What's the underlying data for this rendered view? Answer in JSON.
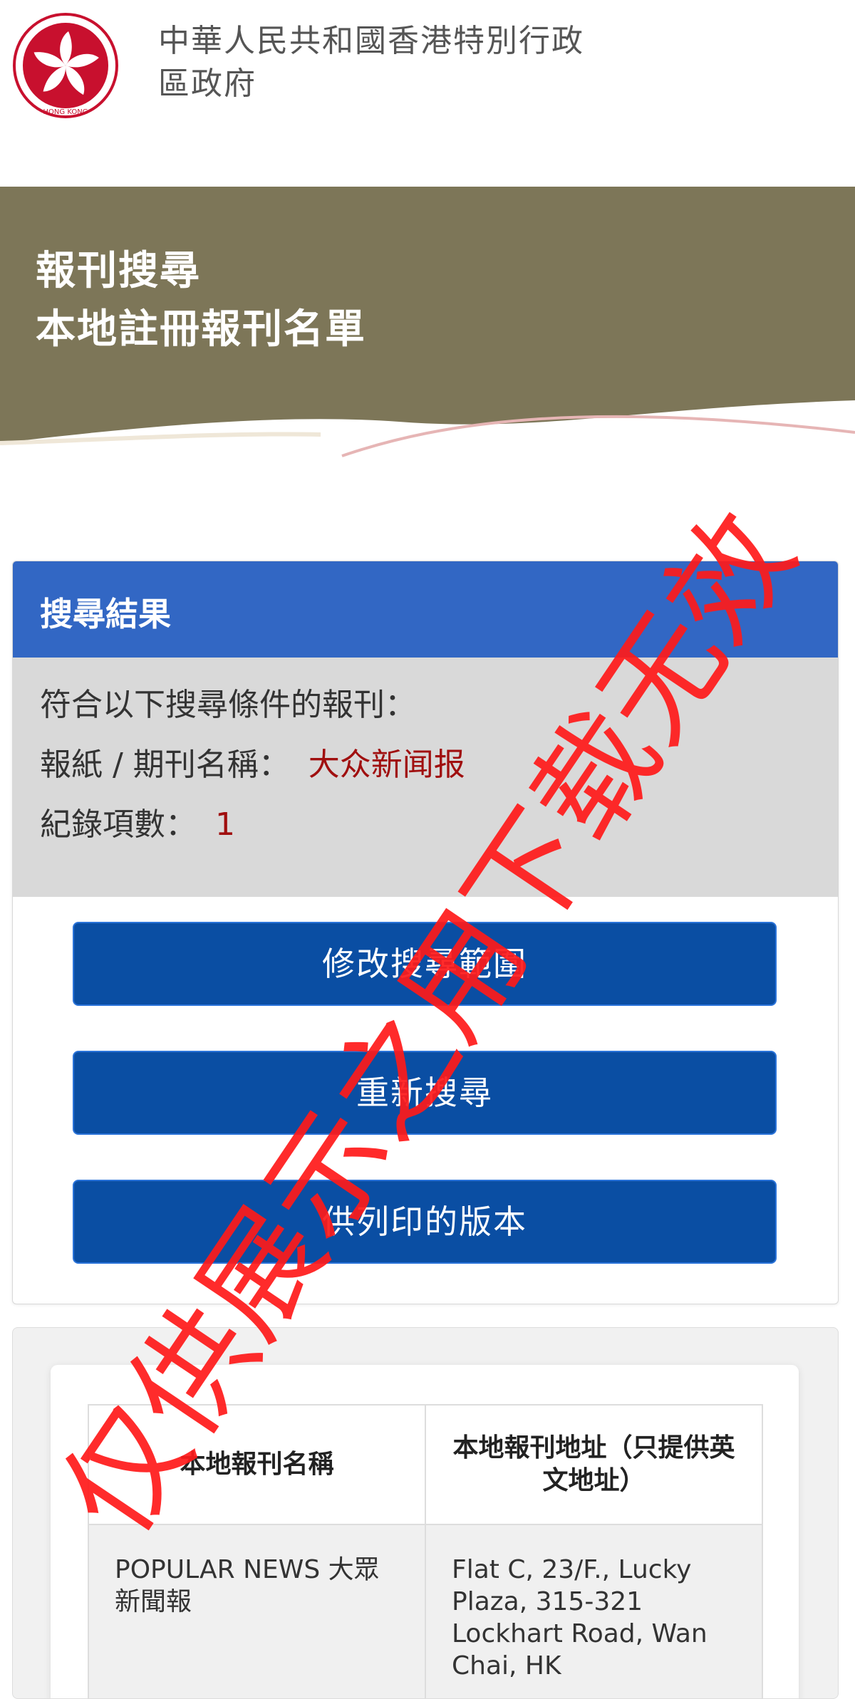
{
  "header": {
    "government_name": "中華人民共和國香港特別行政區政府",
    "emblem_text": "HONG KONG"
  },
  "banner": {
    "line1": "報刊搜尋",
    "line2": "本地註冊報刊名單"
  },
  "results": {
    "heading": "搜尋結果",
    "criteria_intro": "符合以下搜尋條件的報刊：",
    "name_label": "報紙 / 期刊名稱：",
    "name_value": "大众新闻报",
    "count_label": "紀錄項數：",
    "count_value": "1"
  },
  "buttons": {
    "modify": "修改搜尋範圍",
    "new_search": "重新搜尋",
    "print": "供列印的版本"
  },
  "table": {
    "headers": [
      "本地報刊名稱",
      "本地報刊地址（只提供英文地址）"
    ],
    "rows": [
      {
        "name": "POPULAR NEWS 大眾新聞報",
        "address": "Flat C, 23/F., Lucky Plaza, 315-321 Lockhart Road, Wan Chai, HK"
      }
    ]
  },
  "watermark": "仅供展示之用下载无效",
  "colors": {
    "banner": "#7d7658",
    "card_header": "#3267c4",
    "button": "#0a4ea3",
    "highlight_value": "#a00f0f",
    "watermark": "#ff1a1a"
  }
}
